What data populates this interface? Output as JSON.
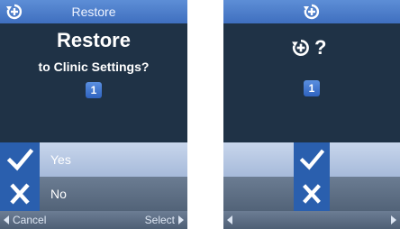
{
  "left_screen": {
    "header": {
      "title": "Restore",
      "icon": "restore-icon"
    },
    "question": {
      "heading": "Restore",
      "subheading": "to Clinic Settings?",
      "badge": "1"
    },
    "options": [
      {
        "label": "Yes",
        "icon": "check-icon",
        "selected": true
      },
      {
        "label": "No",
        "icon": "x-icon",
        "selected": false
      }
    ],
    "footer": {
      "left": "Cancel",
      "right": "Select"
    }
  },
  "right_screen": {
    "header": {
      "icon": "restore-icon"
    },
    "question": {
      "mark": "?",
      "badge": "1"
    },
    "options": [
      {
        "icon": "check-icon",
        "selected": true
      },
      {
        "icon": "x-icon",
        "selected": false
      }
    ]
  },
  "colors": {
    "screen_bg": "#1f3246",
    "title_bar": "#4f7fcc",
    "accent": "#2a5fae",
    "selected_row": "#b7c7e3",
    "unselected_row": "#5f7086"
  }
}
